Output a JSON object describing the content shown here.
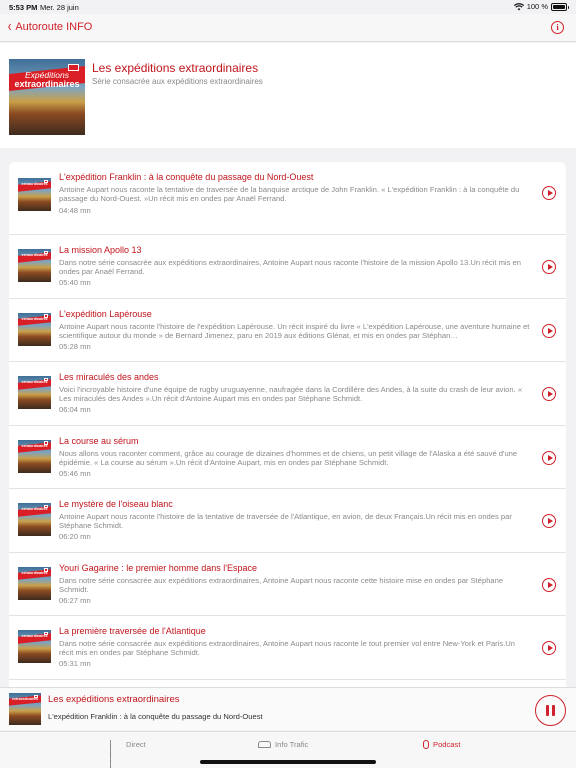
{
  "status_bar": {
    "time": "5:53 PM",
    "date": "Mer. 28 juin",
    "battery": "100 %",
    "battery_level": 1.0,
    "icons": [
      "wifi-icon",
      "battery-icon"
    ]
  },
  "nav": {
    "back_label": "Autoroute INFO",
    "back_icon": "chevron-left-icon",
    "info_icon": "info-icon",
    "info_glyph": "i"
  },
  "podcast": {
    "title": "Les expéditions extraordinaires",
    "subtitle": "Série consacrée aux expéditions extraordinaires",
    "cover_text": [
      "Expéditions",
      "extraordinaires"
    ]
  },
  "episodes": [
    {
      "title": "L'expédition Franklin : à la conquête du passage du Nord-Ouest",
      "description": "Antoine Aupart nous raconte la tentative de traversée de la banquise arctique de John Franklin. « L'expédition Franklin : à la conquête du passage du Nord-Ouest. »Un récit mis en ondes par Anaël Ferrand.",
      "duration": "04:48 mn"
    },
    {
      "title": "La mission Apollo 13",
      "description": "Dans notre série consacrée aux expéditions extraordinaires, Antoine Aupart nous raconte l'histoire de la mission Apollo 13.Un récit mis en ondes par Anaël Ferrand.",
      "duration": "05:40 mn"
    },
    {
      "title": "L'expédition Lapérouse",
      "description": "Antoine Aupart nous raconte l'histoire de l'expédition Lapérouse. Un récit inspiré du livre « L'expédition Lapérouse, une aventure humaine et scientifique autour du monde » de Bernard Jimenez, paru en 2019 aux éditions Glénat, et mis en ondes par Stéphan…",
      "duration": "05:28 mn"
    },
    {
      "title": "Les miraculés des andes",
      "description": "Voici l'incroyable histoire d'une équipe de rugby uruguayenne, naufragée dans la Cordillère des Andes, à la suite du crash de leur avion. « Les miraculés des Andes ».Un récit d'Antoine Aupart mis en ondes par Stéphane Schmidt.",
      "duration": "06:04 mn"
    },
    {
      "title": "La course au sérum",
      "description": "Nous allons vous raconter comment, grâce au courage de dizaines d'hommes et de chiens, un petit village de l'Alaska a été sauvé d'une épidémie. « La course au sérum ».Un récit d'Antoine Aupart, mis en ondes par Stéphane Schmidt.",
      "duration": "05:46 mn"
    },
    {
      "title": "Le mystère de l'oiseau blanc",
      "description": "Antoine Aupart nous raconte l'histoire de la tentative de traversée de l'Atlantique, en avion, de deux Français.Un récit mis en ondes par Stéphane Schmidt.",
      "duration": "06:20 mn"
    },
    {
      "title": "Youri Gagarine : le premier homme dans l'Espace",
      "description": "Dans notre série consacrée aux expéditions extraordinaires, Antoine Aupart nous raconte cette histoire mise en ondes par Stéphane Schmidt.",
      "duration": "06:27 mn"
    },
    {
      "title": "La première traversée de l'Atlantique",
      "description": "Dans notre série consacrée aux expéditions extraordinaires, Antoine Aupart nous raconte le tout premier vol entre New-York et Paris.Un récit mis en ondes par Stéphane Schmidt.",
      "duration": "05:31 mn"
    }
  ],
  "player": {
    "title": "Les expéditions extraordinaires",
    "subtitle": "L'expédition Franklin : à la conquête du passage du Nord-Ouest",
    "state_icon": "pause-icon"
  },
  "tabs": [
    {
      "label": "Direct",
      "icon": "waveform-icon",
      "active": false
    },
    {
      "label": "Info Trafic",
      "icon": "car-icon",
      "active": false
    },
    {
      "label": "Podcast",
      "icon": "microphone-icon",
      "active": true
    }
  ],
  "colors": {
    "accent": "#d1212a",
    "title_red": "#c0141b",
    "secondary_text": "#8a8a8a",
    "background": "#f2f2f4"
  }
}
